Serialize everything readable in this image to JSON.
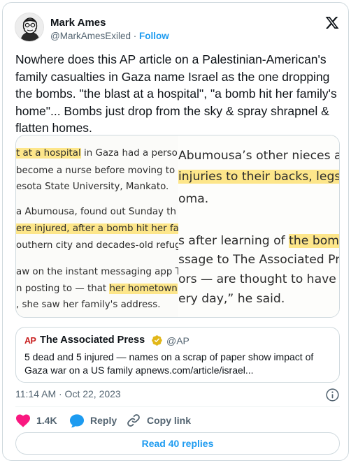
{
  "author": {
    "name": "Mark Ames",
    "handle": "@MarkAmesExiled",
    "separator": " · ",
    "follow_label": "Follow"
  },
  "tweet": {
    "text": "Nowhere does this AP article on a Palestinian-American's family casualties in Gaza name Israel as the one dropping the bombs. \"the blast at a hospital\", \"a bomb hit her family's home\"... Bombs just drop from the sky & spray shrapnel & flatten homes."
  },
  "media": {
    "left_panel": [
      [
        {
          "t": "t at a hospital",
          "hl": true
        },
        {
          "t": " in Gaza had a person"
        }
      ],
      [
        {
          "t": " become a nurse before moving to"
        }
      ],
      [
        {
          "t": "esota State University, Mankato."
        }
      ],
      [
        {
          "t": "a Abumousa, found out Sunday th"
        }
      ],
      [
        {
          "t": "ere injured, after a bomb hit her fa",
          "hl": true
        }
      ],
      [
        {
          "t": "outhern city and decades-old refug"
        }
      ],
      [
        {
          "t": "aw on the instant messaging app T"
        }
      ],
      [
        {
          "t": "n posting to — that "
        },
        {
          "t": "her hometown",
          "hl": true
        }
      ],
      [
        {
          "t": ", she saw her family's address."
        }
      ]
    ],
    "right_panel": [
      [
        {
          "t": "Abumousa’s other nieces a"
        }
      ],
      [
        {
          "t": "injuries to their backs, legs",
          "hl": true
        }
      ],
      [
        {
          "t": "oma."
        }
      ],
      [
        {
          "t": "s after learning of "
        },
        {
          "t": "the bomb",
          "hl": true
        }
      ],
      [
        {
          "t": "ssage to The Associated Pres"
        }
      ],
      [
        {
          "t": "ors — are thought to have bee"
        }
      ],
      [
        {
          "t": "ery day,” he said."
        }
      ]
    ]
  },
  "quote": {
    "logo_text": "AP",
    "name": "The Associated Press",
    "handle": "@AP",
    "text": "5 dead and 5 injured — names on a scrap of paper show impact of Gaza war on a US family  apnews.com/article/israel..."
  },
  "meta": {
    "timestamp": "11:14 AM · Oct 22, 2023"
  },
  "actions": {
    "like_count": "1.4K",
    "reply_label": "Reply",
    "copy_label": "Copy link"
  },
  "read_replies_label": "Read 40 replies",
  "colors": {
    "accent": "#1d9bf0",
    "like": "#f91880",
    "highlight": "#fde68a",
    "verified": "#e2b719",
    "ap_red": "#c81e1e"
  },
  "icons": {
    "platform": "x-logo-icon",
    "verified": "gold-verified-badge-icon",
    "info": "info-icon",
    "like": "heart-icon",
    "reply": "speech-bubble-icon",
    "copy": "link-icon"
  }
}
